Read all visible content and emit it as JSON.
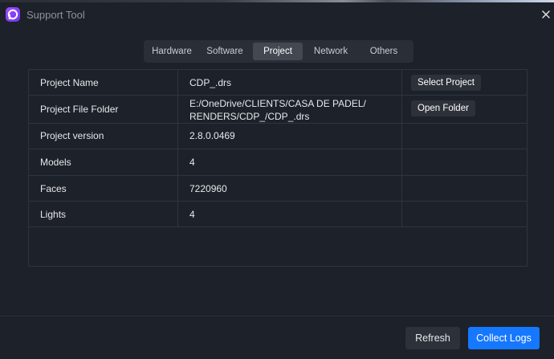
{
  "window": {
    "title": "Support Tool",
    "logo_icon": "p-logo-icon",
    "accent_color": "#1677ff"
  },
  "tabs": [
    {
      "label": "Hardware",
      "active": false
    },
    {
      "label": "Software",
      "active": false
    },
    {
      "label": "Project",
      "active": true
    },
    {
      "label": "Network",
      "active": false
    },
    {
      "label": "Others",
      "active": false
    }
  ],
  "project": {
    "rows": [
      {
        "label": "Project Name",
        "value": "CDP_.drs",
        "button": "Select Project"
      },
      {
        "label": "Project File Folder",
        "value_line1": "E:/OneDrive/CLIENTS/CASA DE PADEL/",
        "value_line2": "RENDERS/CDP_/CDP_.drs",
        "button": "Open Folder"
      },
      {
        "label": "Project version",
        "value": "2.8.0.0469"
      },
      {
        "label": "Models",
        "value": "4"
      },
      {
        "label": "Faces",
        "value": "7220960"
      },
      {
        "label": "Lights",
        "value": "4"
      }
    ]
  },
  "footer": {
    "refresh_label": "Refresh",
    "collect_label": "Collect Logs"
  }
}
